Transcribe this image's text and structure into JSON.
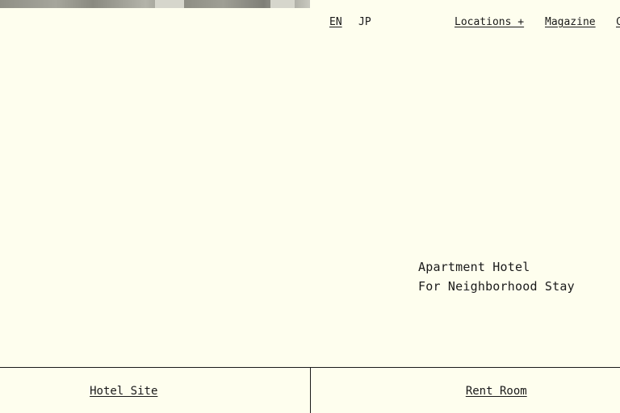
{
  "nav": {
    "languages": [
      "EN",
      "JP"
    ],
    "locations_label": "Locations +",
    "magazine_label": "Magazine",
    "cut_item_label": "C"
  },
  "tagline": {
    "line1": "Apartment Hotel",
    "line2": "For Neighborhood Stay"
  },
  "footer": {
    "hotel_site_label": "Hotel Site",
    "rent_room_label": "Rent Room"
  },
  "colors": {
    "background": "#fefeee",
    "text": "#1a1a1a"
  }
}
